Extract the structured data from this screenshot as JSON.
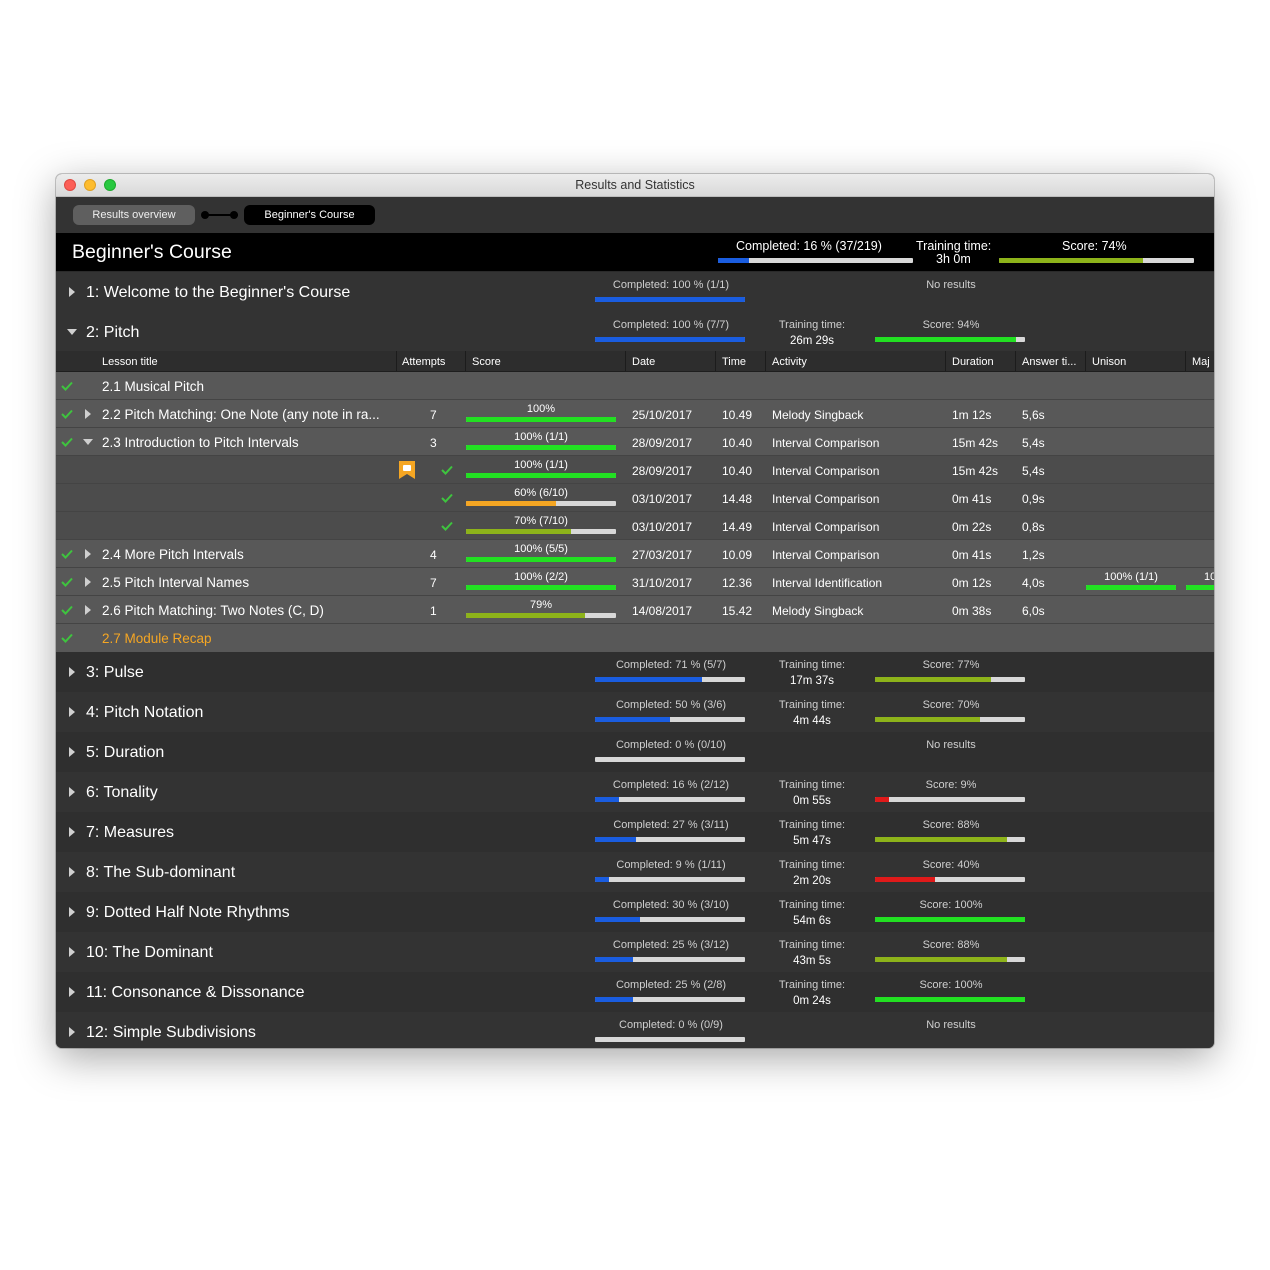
{
  "window": {
    "title": "Results and Statistics"
  },
  "breadcrumbs": {
    "overview": "Results overview",
    "current": "Beginner's Course"
  },
  "course": {
    "title": "Beginner's Course",
    "completed": "Completed: 16 %  (37/219)",
    "completed_fraction": 0.16,
    "training_time_label": "Training time:",
    "training_time": "3h 0m",
    "score": "Score: 74%",
    "score_fraction": 0.74
  },
  "columns": {
    "lesson_title": "Lesson title",
    "attempts": "Attempts",
    "score": "Score",
    "date": "Date",
    "time": "Time",
    "activity": "Activity",
    "duration": "Duration",
    "answer_time": "Answer ti...",
    "unison": "Unison",
    "major": "Maj"
  },
  "module1": {
    "title": "1: Welcome to the Beginner's Course",
    "completed": "Completed: 100 %  (1/1)",
    "fraction": 1.0,
    "no_results": "No results"
  },
  "module2": {
    "title": "2: Pitch",
    "completed": "Completed: 100 %  (7/7)",
    "fraction": 1.0,
    "time_label": "Training time:",
    "time": "26m 29s",
    "score": "Score: 94%",
    "score_fraction": 0.94
  },
  "lessons": [
    {
      "title": "2.1 Musical Pitch"
    },
    {
      "title": "2.2 Pitch Matching: One Note (any note in ra...",
      "attempts": "7",
      "score": "100%",
      "score_fraction": 1.0,
      "date": "25/10/2017",
      "time": "10.49",
      "activity": "Melody Singback",
      "duration": "1m 12s",
      "answer_time": "5,6s"
    },
    {
      "title": "2.3 Introduction to Pitch Intervals",
      "attempts": "3",
      "score": "100%  (1/1)",
      "score_fraction": 1.0,
      "date": "28/09/2017",
      "time": "10.40",
      "activity": "Interval Comparison",
      "duration": "15m 42s",
      "answer_time": "5,4s"
    },
    {
      "title": "2.4 More Pitch Intervals",
      "attempts": "4",
      "score": "100%  (5/5)",
      "score_fraction": 1.0,
      "date": "27/03/2017",
      "time": "10.09",
      "activity": "Interval Comparison",
      "duration": "0m 41s",
      "answer_time": "1,2s"
    },
    {
      "title": "2.5 Pitch Interval Names",
      "attempts": "7",
      "score": "100%  (2/2)",
      "score_fraction": 1.0,
      "date": "31/10/2017",
      "time": "12.36",
      "activity": "Interval Identification",
      "duration": "0m 12s",
      "answer_time": "4,0s",
      "unison": "100%  (1/1)",
      "unison_fraction": 1.0,
      "major_partial": "10"
    },
    {
      "title": "2.6 Pitch Matching: Two Notes (C, D)",
      "attempts": "1",
      "score": "79%",
      "score_fraction": 0.79,
      "date": "14/08/2017",
      "time": "15.42",
      "activity": "Melody Singback",
      "duration": "0m 38s",
      "answer_time": "6,0s"
    },
    {
      "title": "2.7 Module Recap"
    }
  ],
  "attempts_2_3": [
    {
      "score": "100%  (1/1)",
      "score_fraction": 1.0,
      "date": "28/09/2017",
      "time": "10.40",
      "activity": "Interval Comparison",
      "duration": "15m 42s",
      "answer_time": "5,4s"
    },
    {
      "score": "60%  (6/10)",
      "score_fraction": 0.6,
      "date": "03/10/2017",
      "time": "14.48",
      "activity": "Interval Comparison",
      "duration": "0m 41s",
      "answer_time": "0,9s"
    },
    {
      "score": "70%  (7/10)",
      "score_fraction": 0.7,
      "date": "03/10/2017",
      "time": "14.49",
      "activity": "Interval Comparison",
      "duration": "0m 22s",
      "answer_time": "0,8s"
    }
  ],
  "modules": [
    {
      "title": "3: Pulse",
      "completed": "Completed: 71 %  (5/7)",
      "fraction": 0.71,
      "time_label": "Training time:",
      "time": "17m 37s",
      "score": "Score: 77%",
      "score_fraction": 0.77
    },
    {
      "title": "4: Pitch Notation",
      "completed": "Completed: 50 %  (3/6)",
      "fraction": 0.5,
      "time_label": "Training time:",
      "time": "4m 44s",
      "score": "Score: 70%",
      "score_fraction": 0.7
    },
    {
      "title": "5: Duration",
      "completed": "Completed: 0 %  (0/10)",
      "fraction": 0.0,
      "no_results": "No results"
    },
    {
      "title": "6: Tonality",
      "completed": "Completed: 16 %  (2/12)",
      "fraction": 0.16,
      "time_label": "Training time:",
      "time": "0m 55s",
      "score": "Score: 9%",
      "score_fraction": 0.09
    },
    {
      "title": "7: Measures",
      "completed": "Completed: 27 %  (3/11)",
      "fraction": 0.27,
      "time_label": "Training time:",
      "time": "5m 47s",
      "score": "Score: 88%",
      "score_fraction": 0.88
    },
    {
      "title": "8: The Sub-dominant",
      "completed": "Completed: 9 %  (1/11)",
      "fraction": 0.09,
      "time_label": "Training time:",
      "time": "2m 20s",
      "score": "Score: 40%",
      "score_fraction": 0.4
    },
    {
      "title": "9: Dotted Half Note Rhythms",
      "completed": "Completed: 30 %  (3/10)",
      "fraction": 0.3,
      "time_label": "Training time:",
      "time": "54m 6s",
      "score": "Score: 100%",
      "score_fraction": 1.0
    },
    {
      "title": "10: The Dominant",
      "completed": "Completed: 25 %  (3/12)",
      "fraction": 0.25,
      "time_label": "Training time:",
      "time": "43m 5s",
      "score": "Score: 88%",
      "score_fraction": 0.88
    },
    {
      "title": "11: Consonance & Dissonance",
      "completed": "Completed: 25 %  (2/8)",
      "fraction": 0.25,
      "time_label": "Training time:",
      "time": "0m 24s",
      "score": "Score: 100%",
      "score_fraction": 1.0
    },
    {
      "title": "12: Simple Subdivisions",
      "completed": "Completed: 0 %  (0/9)",
      "fraction": 0.0,
      "no_results": "No results"
    }
  ],
  "colors": {
    "progress": "#1a5de0",
    "score_high": "#22e022",
    "score_mid": "#8db31a",
    "score_low": "#e01a1a",
    "score_orange": "#f5a623",
    "check": "#3ec43e",
    "accent_recap": "#f5a623"
  },
  "icons": {
    "expand": "triangle-right-icon",
    "collapse": "triangle-down-icon",
    "check": "checkmark-icon",
    "flag": "flag-badge-icon"
  }
}
